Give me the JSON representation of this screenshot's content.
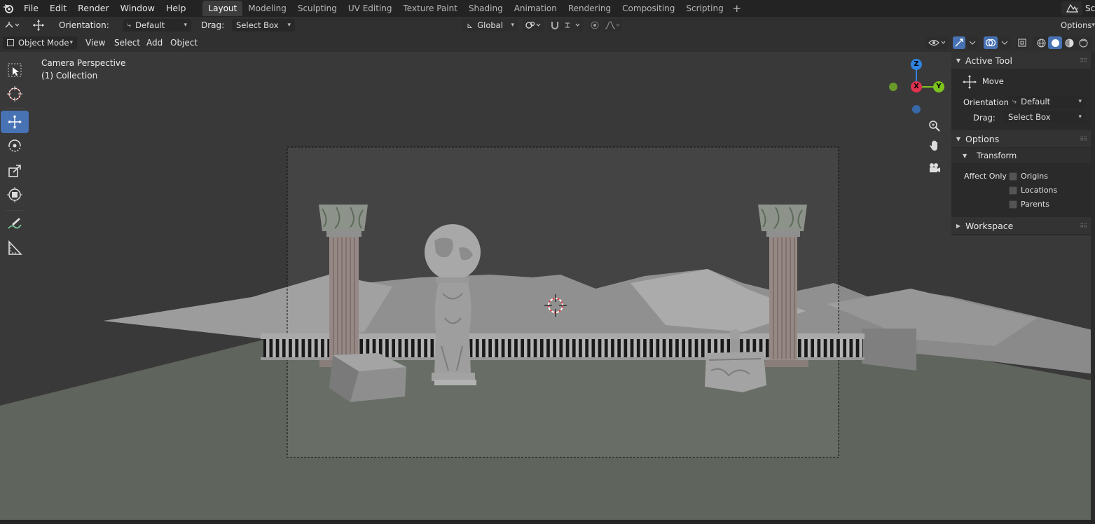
{
  "topbar": {
    "menus": [
      "File",
      "Edit",
      "Render",
      "Window",
      "Help"
    ],
    "workspaces": [
      "Layout",
      "Modeling",
      "Sculpting",
      "UV Editing",
      "Texture Paint",
      "Shading",
      "Animation",
      "Rendering",
      "Compositing",
      "Scripting"
    ],
    "active_workspace": "Layout",
    "add_workspace": "+",
    "scene_truncated": "Sc"
  },
  "tool_header": {
    "orientation_label": "Orientation:",
    "orientation_value": "Default",
    "drag_label": "Drag:",
    "drag_value": "Select Box",
    "transform_orientation": "Global",
    "options_label": "Options"
  },
  "viewport_header": {
    "mode": "Object Mode",
    "menus": [
      "View",
      "Select",
      "Add",
      "Object"
    ]
  },
  "viewport": {
    "camera_label": "Camera Perspective",
    "collection_label": "(1) Collection",
    "gizmo": {
      "z": "Z",
      "x": "X",
      "y": "Y"
    },
    "colors": {
      "background": "#393939",
      "camera_frame": "#4a4a4a",
      "ground": "#6c7268",
      "accent": "#4772b3"
    }
  },
  "npanel": {
    "active_tool": {
      "title": "Active Tool",
      "tool_name": "Move",
      "orientation_label": "Orientation",
      "orientation_value": "Default",
      "drag_label": "Drag:",
      "drag_value": "Select Box"
    },
    "options": {
      "title": "Options",
      "transform_title": "Transform",
      "affect_only_label": "Affect Only",
      "checkboxes": [
        "Origins",
        "Locations",
        "Parents"
      ]
    },
    "workspace": {
      "title": "Workspace"
    }
  }
}
